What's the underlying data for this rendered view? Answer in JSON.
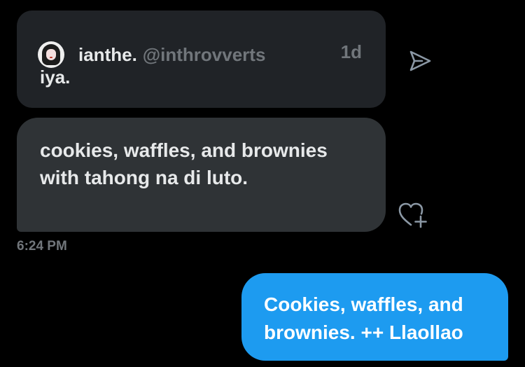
{
  "quoted_message": {
    "avatar_icon": "user-avatar-icon",
    "author_name": "ianthe.",
    "author_handle": "@inthrovverts",
    "time_ago": "1d",
    "text": "iya."
  },
  "share_button": {
    "icon": "send-icon"
  },
  "incoming_message": {
    "text": "cookies, waffles, and brownies with tahong na di luto."
  },
  "react_button": {
    "icon": "heart-plus-icon"
  },
  "message_timestamp": "6:24 PM",
  "outgoing_message": {
    "text": "Cookies, waffles, and brownies. ++ Llaollao"
  },
  "colors": {
    "background": "#000000",
    "quoted_card_bg": "#202327",
    "incoming_bubble_bg": "#2f3336",
    "outgoing_bubble_bg": "#1d9bf0",
    "muted_text": "#71767b",
    "primary_text": "#e7e9ea"
  }
}
